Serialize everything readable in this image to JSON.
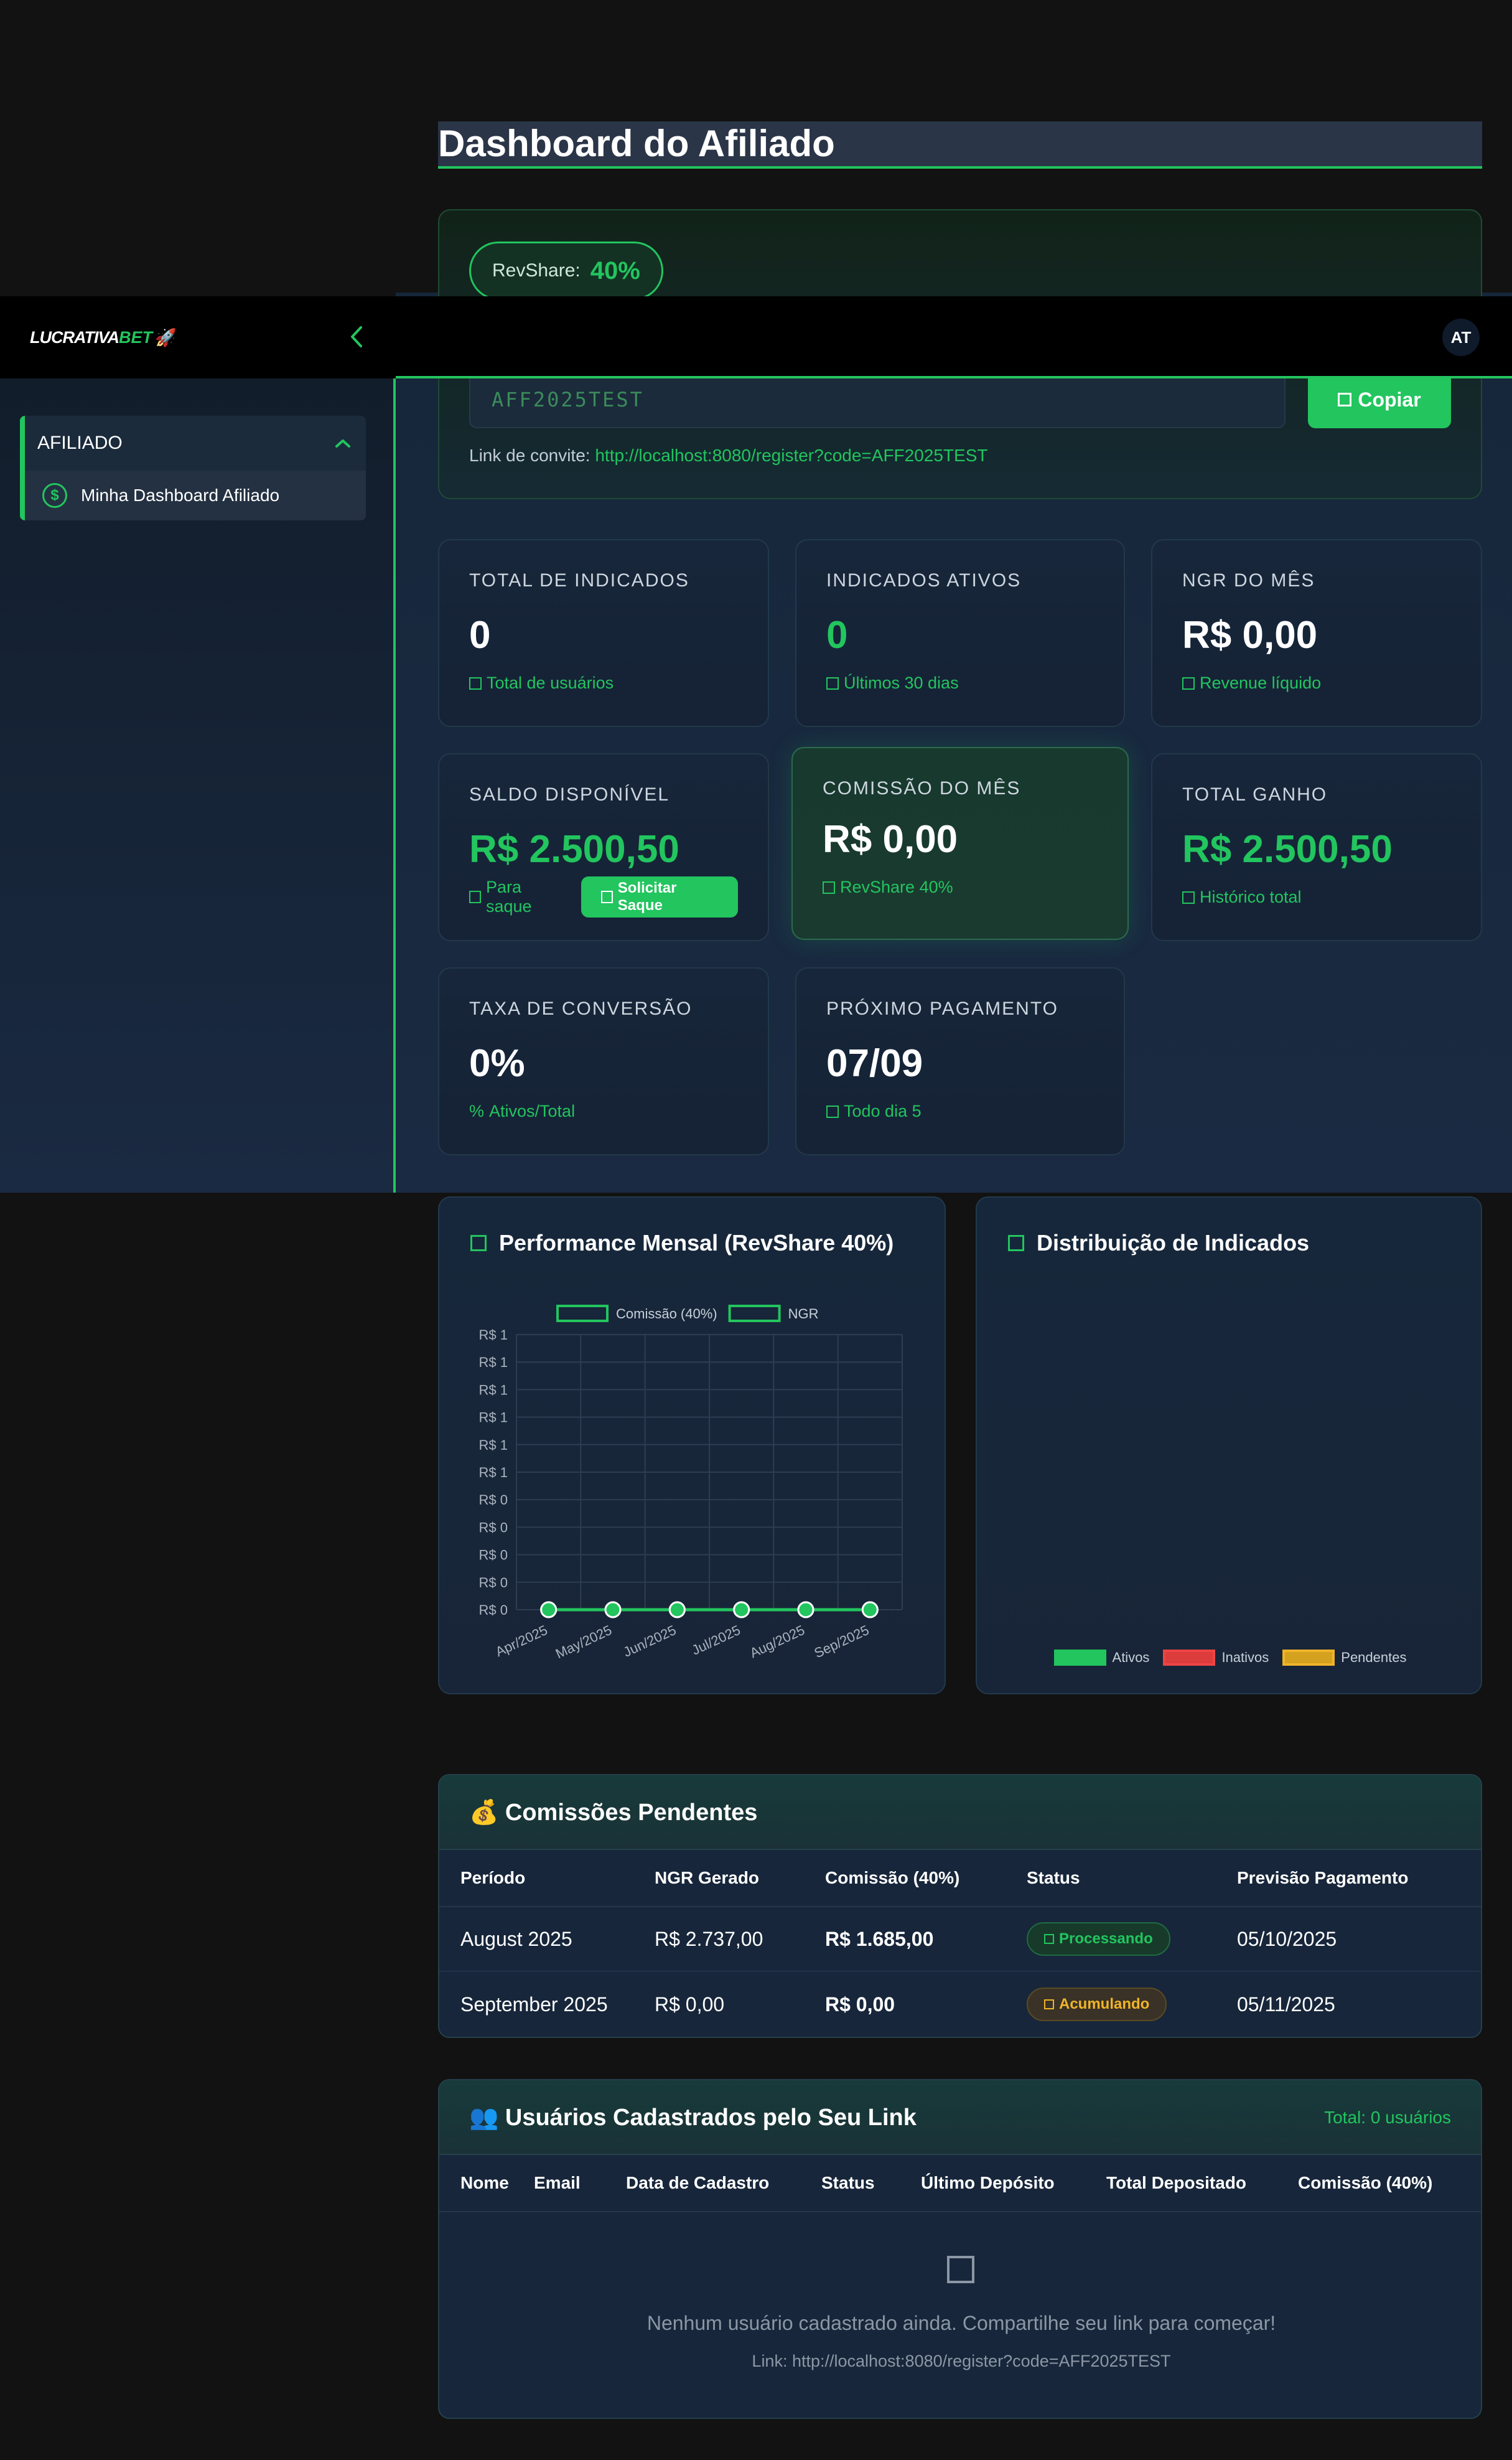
{
  "page": {
    "title": "Dashboard do Afiliado"
  },
  "navbar": {
    "logo_part1": "LUCRATIVA",
    "logo_part2": "BET",
    "logo_icon": "🚀",
    "avatar_initials": "AT"
  },
  "sidebar": {
    "section_label": "AFILIADO",
    "items": [
      {
        "label": "Minha Dashboard Afiliado",
        "icon": "dollar-icon"
      }
    ]
  },
  "invite": {
    "revshare_label": "RevShare:",
    "revshare_value": "40%",
    "code": "AFF2025TEST",
    "copy_label": "Copiar",
    "link_label": "Link de convite:",
    "link_url": "http://localhost:8080/register?code=AFF2025TEST"
  },
  "stats": {
    "total_indicados": {
      "label": "TOTAL DE INDICADOS",
      "value": "0",
      "sub": "Total de usuários"
    },
    "indicados_ativos": {
      "label": "INDICADOS ATIVOS",
      "value": "0",
      "sub": "Últimos 30 dias"
    },
    "ngr_mes": {
      "label": "NGR DO MÊS",
      "value": "R$ 0,00",
      "sub": "Revenue líquido"
    },
    "saldo": {
      "label": "SALDO DISPONÍVEL",
      "value": "R$ 2.500,50",
      "sub": "Para saque",
      "button": "Solicitar Saque"
    },
    "comissao_mes": {
      "label": "COMISSÃO DO MÊS",
      "value": "R$ 0,00",
      "sub": "RevShare 40%"
    },
    "total_ganho": {
      "label": "TOTAL GANHO",
      "value": "R$ 2.500,50",
      "sub": "Histórico total"
    },
    "taxa_conversao": {
      "label": "TAXA DE CONVERSÃO",
      "value": "0%",
      "sub_icon": "%",
      "sub": "Ativos/Total"
    },
    "proximo_pagamento": {
      "label": "PRÓXIMO PAGAMENTO",
      "value": "07/09",
      "sub": "Todo dia 5"
    }
  },
  "performance_chart": {
    "title": "Performance Mensal (RevShare 40%)",
    "legend": [
      "Comissão (40%)",
      "NGR"
    ]
  },
  "distribution_chart": {
    "title": "Distribuição de Indicados",
    "legend": [
      {
        "label": "Ativos",
        "color": "#22c55e"
      },
      {
        "label": "Inativos",
        "color": "#ef4444"
      },
      {
        "label": "Pendentes",
        "color": "#f0b429"
      }
    ]
  },
  "chart_data": [
    {
      "type": "line",
      "title": "Performance Mensal (RevShare 40%)",
      "categories": [
        "Apr/2025",
        "May/2025",
        "Jun/2025",
        "Jul/2025",
        "Aug/2025",
        "Sep/2025"
      ],
      "series": [
        {
          "name": "Comissão (40%)",
          "values": [
            0,
            0,
            0,
            0,
            0,
            0
          ]
        },
        {
          "name": "NGR",
          "values": [
            0,
            0,
            0,
            0,
            0,
            0
          ]
        }
      ],
      "ytick_labels": [
        "R$ 1",
        "R$ 1",
        "R$ 1",
        "R$ 1",
        "R$ 1",
        "R$ 1",
        "R$ 0",
        "R$ 0",
        "R$ 0",
        "R$ 0",
        "R$ 0"
      ],
      "ylim": [
        0,
        1
      ],
      "grid": true,
      "legend": "top",
      "color": "#22c55e"
    },
    {
      "type": "pie",
      "title": "Distribuição de Indicados",
      "categories": [
        "Ativos",
        "Inativos",
        "Pendentes"
      ],
      "values": [
        0,
        0,
        0
      ],
      "legend": "bottom"
    }
  ],
  "pending_table": {
    "title": "Comissões Pendentes",
    "title_icon": "💰",
    "columns": [
      "Período",
      "NGR Gerado",
      "Comissão (40%)",
      "Status",
      "Previsão Pagamento"
    ],
    "rows": [
      {
        "periodo": "August 2025",
        "ngr": "R$ 2.737,00",
        "comissao": "R$ 1.685,00",
        "status": "Processando",
        "previsao": "05/10/2025"
      },
      {
        "periodo": "September 2025",
        "ngr": "R$ 0,00",
        "comissao": "R$ 0,00",
        "status": "Acumulando",
        "previsao": "05/11/2025"
      }
    ]
  },
  "users_table": {
    "title": "Usuários Cadastrados pelo Seu Link",
    "title_icon": "👥",
    "total": "Total: 0 usuários",
    "columns": [
      "Nome",
      "Email",
      "Data de Cadastro",
      "Status",
      "Último Depósito",
      "Total Depositado",
      "Comissão (40%)"
    ],
    "empty_message": "Nenhum usuário cadastrado ainda. Compartilhe seu link para começar!",
    "empty_link": "Link: http://localhost:8080/register?code=AFF2025TEST"
  }
}
